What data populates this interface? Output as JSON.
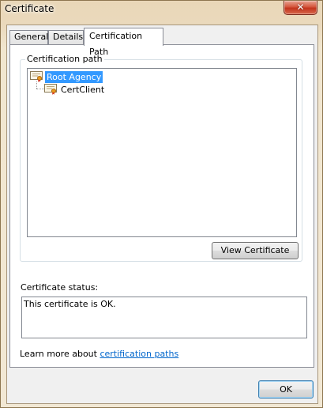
{
  "window": {
    "title": "Certificate",
    "close_glyph": "✕"
  },
  "tabs": [
    {
      "label": "General"
    },
    {
      "label": "Details"
    },
    {
      "label": "Certification Path",
      "active": true
    }
  ],
  "path_group": {
    "legend": "Certification path",
    "nodes": [
      {
        "label": "Root Agency",
        "icon": "certificate-icon",
        "selected": true
      },
      {
        "label": "CertClient",
        "icon": "certificate-icon",
        "selected": false
      }
    ],
    "view_button": "View Certificate"
  },
  "status": {
    "label": "Certificate status:",
    "text": "This certificate is OK."
  },
  "learn_more": {
    "prefix": "Learn more about ",
    "link": "certification paths"
  },
  "ok_button": "OK",
  "colors": {
    "selection": "#3399ff",
    "link": "#0066cc",
    "close_button": "#c3341d"
  }
}
